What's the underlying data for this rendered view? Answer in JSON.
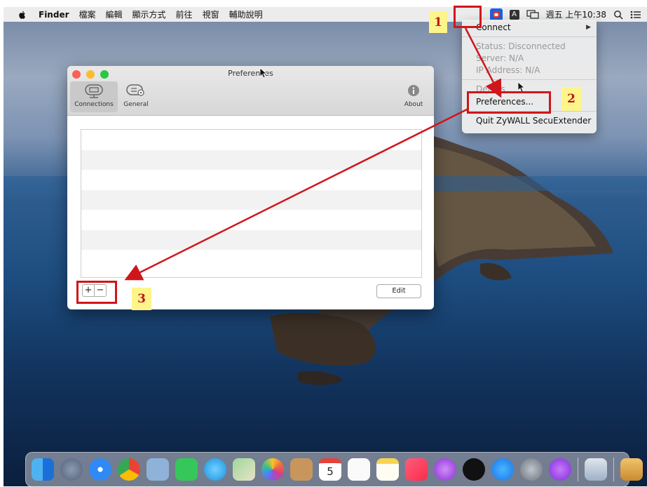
{
  "menubar": {
    "apple_icon": "apple-icon",
    "app_name": "Finder",
    "items": [
      "檔案",
      "編輯",
      "顯示方式",
      "前往",
      "視窗",
      "輔助說明"
    ],
    "clock": "週五 上午10:38",
    "input_badge": "A"
  },
  "window": {
    "title": "Preferences",
    "tabs": [
      {
        "label": "Connections",
        "icon": "connections-icon"
      },
      {
        "label": "General",
        "icon": "general-icon"
      }
    ],
    "about_label": "About",
    "add_symbol": "+",
    "remove_symbol": "−",
    "edit_label": "Edit"
  },
  "tray_menu": {
    "connect": "Connect",
    "status": "Status: Disconnected",
    "server": "Server: N/A",
    "ip": "IP Address: N/A",
    "details": "Details",
    "preferences": "Preferences...",
    "quit": "Quit ZyWALL SecuExtender"
  },
  "annotations": {
    "step1": "1",
    "step2": "2",
    "step3": "3",
    "color": "#d0161b",
    "badge_color": "#fdf58a"
  },
  "dock": {
    "icons": [
      "finder-icon",
      "launchpad-icon",
      "safari-icon",
      "chrome-icon",
      "mail-stamp-icon",
      "facetime-icon",
      "messages-icon",
      "maps-icon",
      "photos-icon",
      "contacts-icon",
      "calendar-icon",
      "reminders-icon",
      "notes-icon",
      "music-icon",
      "podcasts-icon",
      "apple-tv-icon",
      "app-store-icon",
      "system-preferences-icon",
      "feedback-icon",
      "preview-icon",
      "package-icon",
      "trash-icon"
    ],
    "calendar_day": "5"
  }
}
